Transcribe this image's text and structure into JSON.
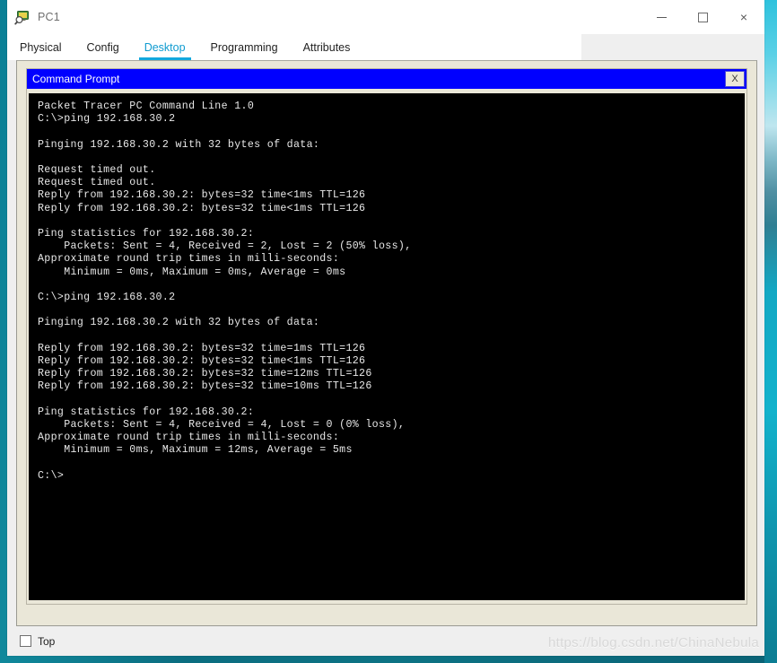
{
  "window": {
    "title": "PC1",
    "icon": "pc-device-icon",
    "controls": {
      "minimize_label": "—",
      "maximize_label": "□",
      "close_label": "×"
    }
  },
  "tabs": [
    {
      "label": "Physical",
      "active": false
    },
    {
      "label": "Config",
      "active": false
    },
    {
      "label": "Desktop",
      "active": true
    },
    {
      "label": "Programming",
      "active": false
    },
    {
      "label": "Attributes",
      "active": false
    }
  ],
  "command_prompt": {
    "title": "Command Prompt",
    "close_button_label": "X",
    "console_text": "Packet Tracer PC Command Line 1.0\nC:\\>ping 192.168.30.2\n\nPinging 192.168.30.2 with 32 bytes of data:\n\nRequest timed out.\nRequest timed out.\nReply from 192.168.30.2: bytes=32 time<1ms TTL=126\nReply from 192.168.30.2: bytes=32 time<1ms TTL=126\n\nPing statistics for 192.168.30.2:\n    Packets: Sent = 4, Received = 2, Lost = 2 (50% loss),\nApproximate round trip times in milli-seconds:\n    Minimum = 0ms, Maximum = 0ms, Average = 0ms\n\nC:\\>ping 192.168.30.2\n\nPinging 192.168.30.2 with 32 bytes of data:\n\nReply from 192.168.30.2: bytes=32 time=1ms TTL=126\nReply from 192.168.30.2: bytes=32 time<1ms TTL=126\nReply from 192.168.30.2: bytes=32 time=12ms TTL=126\nReply from 192.168.30.2: bytes=32 time=10ms TTL=126\n\nPing statistics for 192.168.30.2:\n    Packets: Sent = 4, Received = 4, Lost = 0 (0% loss),\nApproximate round trip times in milli-seconds:\n    Minimum = 0ms, Maximum = 12ms, Average = 5ms\n\nC:\\>"
  },
  "footer": {
    "top_checkbox_label": "Top",
    "top_checkbox_checked": false
  },
  "watermark": {
    "text": "https://blog.csdn.net/ChinaNebula"
  },
  "colors": {
    "desktop_teal": "#0d7384",
    "accent_tab": "#12a8de",
    "cmd_titlebar_blue": "#0000ff",
    "panel_beige": "#eae7d8",
    "console_bg": "#000000",
    "console_fg": "#e8e8e8"
  }
}
